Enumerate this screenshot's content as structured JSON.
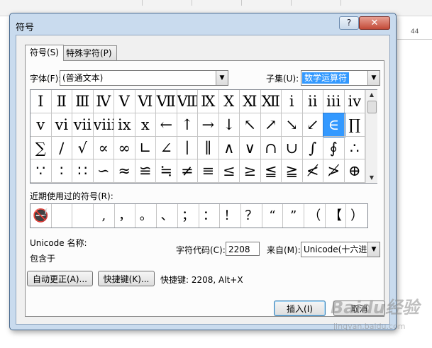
{
  "background": {
    "ruler_number": "44",
    "watermark_logo": "Baidu经验",
    "watermark_url": "jingyan.baidu.com"
  },
  "dialog": {
    "title": "符号",
    "help_button": "?",
    "close_button": "✕",
    "tabs": [
      {
        "label": "符号(S)",
        "active": true
      },
      {
        "label": "特殊字符(P)",
        "active": false
      }
    ],
    "font_label": "字体(F):",
    "font_value": "(普通文本)",
    "subset_label": "子集(U):",
    "subset_value": "数学运算符",
    "grid_rows": [
      [
        "Ⅰ",
        "Ⅱ",
        "Ⅲ",
        "Ⅳ",
        "Ⅴ",
        "Ⅵ",
        "Ⅶ",
        "Ⅷ",
        "Ⅸ",
        "Ⅹ",
        "Ⅺ",
        "Ⅻ",
        "ⅰ",
        "ⅱ",
        "ⅲ",
        "ⅳ"
      ],
      [
        "ⅴ",
        "ⅵ",
        "ⅶ",
        "ⅷ",
        "ⅸ",
        "ⅹ",
        "←",
        "↑",
        "→",
        "↓",
        "↖",
        "↗",
        "↘",
        "↙",
        "∈",
        "∏"
      ],
      [
        "∑",
        "∕",
        "√",
        "∝",
        "∞",
        "∟",
        "∠",
        "∣",
        "∥",
        "∧",
        "∨",
        "∩",
        "∪",
        "∫",
        "∮",
        "∴"
      ],
      [
        "∵",
        "∶",
        "∷",
        "∽",
        "≈",
        "≌",
        "≒",
        "≠",
        "≡",
        "≤",
        "≥",
        "≦",
        "≧",
        "≮",
        "≯",
        "⊕"
      ]
    ],
    "selected_symbol": "∈",
    "recent_label": "近期使用过的符号(R):",
    "recent_symbols": [
      "🚭",
      "",
      "",
      ",",
      "，",
      "。",
      "、",
      "；",
      "：",
      "！",
      "？",
      "“",
      "”",
      "（",
      "【",
      "）"
    ],
    "unicode_name_label": "Unicode 名称:",
    "unicode_name_value": "包含于",
    "char_code_label": "字符代码(C):",
    "char_code_value": "2208",
    "from_label": "来自(M):",
    "from_value": "Unicode(十六进",
    "autocorrect_button": "自动更正(A)...",
    "shortcut_key_button": "快捷键(K)...",
    "shortcut_text": "快捷键: 2208, Alt+X",
    "insert_button": "插入(I)",
    "cancel_button": "取消"
  }
}
